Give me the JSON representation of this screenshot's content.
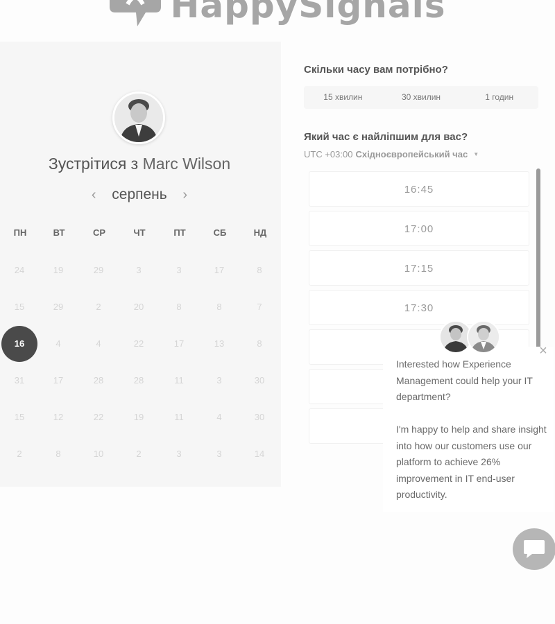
{
  "brand": {
    "name": "HappySignals"
  },
  "host": {
    "meet_prefix": "Зустрітися з",
    "name": "Marc Wilson"
  },
  "calendar": {
    "month": "серпень",
    "weekdays": [
      "ПН",
      "ВТ",
      "СР",
      "ЧТ",
      "ПТ",
      "СБ",
      "НД"
    ],
    "weeks": [
      [
        "24",
        "19",
        "29",
        "3",
        "3",
        "17",
        "8"
      ],
      [
        "15",
        "29",
        "2",
        "20",
        "8",
        "8",
        "7"
      ],
      [
        "16",
        "4",
        "4",
        "22",
        "17",
        "13",
        "8"
      ],
      [
        "31",
        "17",
        "28",
        "28",
        "11",
        "3",
        "30"
      ],
      [
        "15",
        "12",
        "22",
        "19",
        "11",
        "4",
        "30"
      ],
      [
        "2",
        "8",
        "10",
        "2",
        "3",
        "3",
        "14"
      ]
    ],
    "selected_day": "16"
  },
  "duration": {
    "question": "Скільки часу вам потрібно?",
    "options": [
      "15 хвилин",
      "30 хвилин",
      "1 годин"
    ]
  },
  "time": {
    "question": "Який час є найліпшим для вас?",
    "timezone_offset": "UTC +03:00",
    "timezone_name": "Східноєвропейський час",
    "slots": [
      "16:45",
      "17:00",
      "17:15",
      "17:30",
      "",
      "",
      ""
    ]
  },
  "chat": {
    "message_1": "Interested how Experience Management could help your IT department?",
    "message_2": "I'm happy to help and share insight into how our customers use our platform to achieve 26% improvement in IT end-user productivity."
  }
}
